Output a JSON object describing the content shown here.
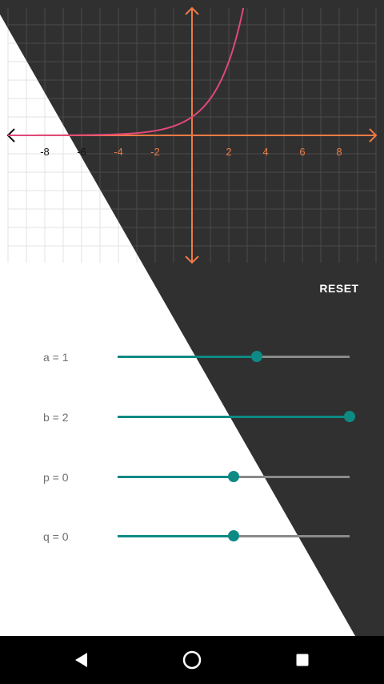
{
  "colors": {
    "dark_background": "#303030",
    "light_background": "#ffffff",
    "grid_line": "#4a4a4a",
    "axis": "#ef7a45",
    "curve": "#e0487a",
    "slider_accent": "#0e8a85",
    "slider_track": "#8a8a8a",
    "label_text": "#6f6f6f",
    "reset_text": "#ffffff",
    "nav_bar": "#000000"
  },
  "graph": {
    "x_range": [
      -10,
      10
    ],
    "y_range": [
      -7,
      7
    ],
    "x_tick_labels": [
      "-8",
      "-6",
      "-4",
      "-2",
      "2",
      "4",
      "6",
      "8"
    ],
    "x_tick_values": [
      -8,
      -6,
      -4,
      -2,
      2,
      4,
      6,
      8
    ],
    "grid": true,
    "function": "y = a·b^(x−p) + q"
  },
  "reset_button": {
    "label": "RESET"
  },
  "sliders": [
    {
      "symbol": "a",
      "value": "1",
      "fraction": 0.6
    },
    {
      "symbol": "b",
      "value": "2",
      "fraction": 1.0
    },
    {
      "symbol": "p",
      "value": "0",
      "fraction": 0.5
    },
    {
      "symbol": "q",
      "value": "0",
      "fraction": 0.5
    }
  ],
  "nav_bar": {
    "back": "back-triangle-icon",
    "home": "home-circle-icon",
    "recents": "recents-square-icon"
  }
}
